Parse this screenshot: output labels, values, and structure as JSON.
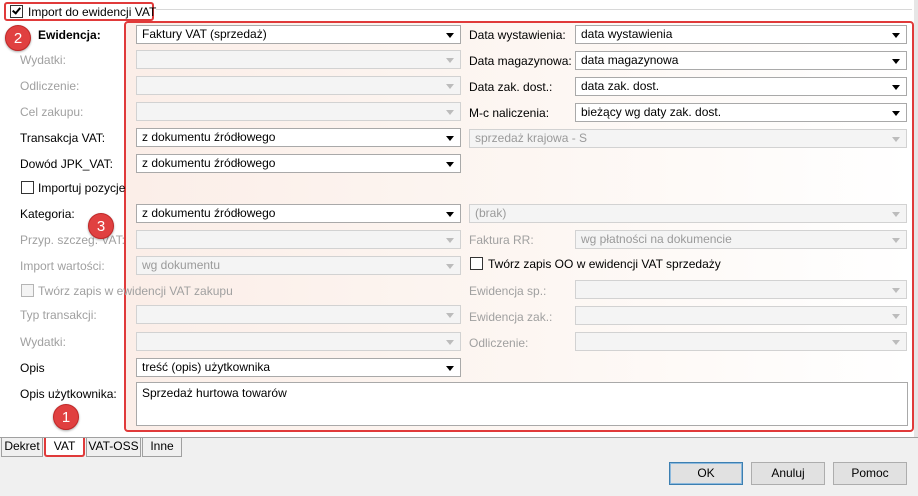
{
  "group_header": {
    "checked": true,
    "label": "Import do ewidencji VAT"
  },
  "badges": {
    "b1": "1",
    "b2": "2",
    "b3": "3"
  },
  "left": {
    "ewidencja": {
      "label": "Ewidencja:",
      "value": "Faktury VAT (sprzedaż)"
    },
    "wydatki": {
      "label": "Wydatki:",
      "value": ""
    },
    "odliczenie": {
      "label": "Odliczenie:",
      "value": ""
    },
    "cel_zakupu": {
      "label": "Cel zakupu:",
      "value": ""
    },
    "transakcja": {
      "label": "Transakcja VAT:",
      "value": "z dokumentu źródłowego"
    },
    "dowod": {
      "label": "Dowód JPK_VAT:",
      "value": "z dokumentu źródłowego"
    },
    "importuj_pozycje": {
      "label": "Importuj pozycje",
      "checked": false
    },
    "kategoria": {
      "label": "Kategoria:",
      "value": "z dokumentu źródłowego"
    },
    "przyp": {
      "label": "Przyp. szczeg. VAT:",
      "value": ""
    },
    "import_wartosci": {
      "label": "Import wartości:",
      "value": "wg dokumentu"
    },
    "tworz_zakup": {
      "label": "Twórz zapis w ewidencji VAT zakupu",
      "checked": false
    },
    "typ_transakcji": {
      "label": "Typ transakcji:",
      "value": ""
    },
    "wydatki2": {
      "label": "Wydatki:",
      "value": ""
    },
    "opis": {
      "label": "Opis",
      "value": "treść (opis) użytkownika"
    },
    "opis_uzytkownika": {
      "label": "Opis użytkownika:",
      "value": "Sprzedaż hurtowa towarów"
    }
  },
  "right": {
    "data_wystawienia": {
      "label": "Data wystawienia:",
      "value": "data wystawienia"
    },
    "data_magazynowa": {
      "label": "Data magazynowa:",
      "value": "data magazynowa"
    },
    "data_zak": {
      "label": "Data zak. dost.:",
      "value": "data zak. dost."
    },
    "mc_naliczenia": {
      "label": "M-c naliczenia:",
      "value": "bieżący wg daty zak. dost."
    },
    "transakcja_value": "sprzedaż krajowa - S",
    "kategoria_value": "(brak)",
    "faktura_rr": {
      "label": "Faktura RR:",
      "value": "wg płatności na dokumencie"
    },
    "tworz_oo": {
      "label": "Twórz zapis OO w ewidencji VAT sprzedaży",
      "checked": false
    },
    "ewidencja_sp": {
      "label": "Ewidencja sp.:",
      "value": ""
    },
    "ewidencja_zak": {
      "label": "Ewidencja zak.:",
      "value": ""
    },
    "odliczenie": {
      "label": "Odliczenie:",
      "value": ""
    }
  },
  "tabs": [
    "Dekret",
    "VAT",
    "VAT-OSS",
    "Inne"
  ],
  "buttons": {
    "ok": "OK",
    "cancel": "Anuluj",
    "help": "Pomoc"
  },
  "colors": {
    "highlight": "#e03a3a",
    "badge": "#e04040"
  }
}
